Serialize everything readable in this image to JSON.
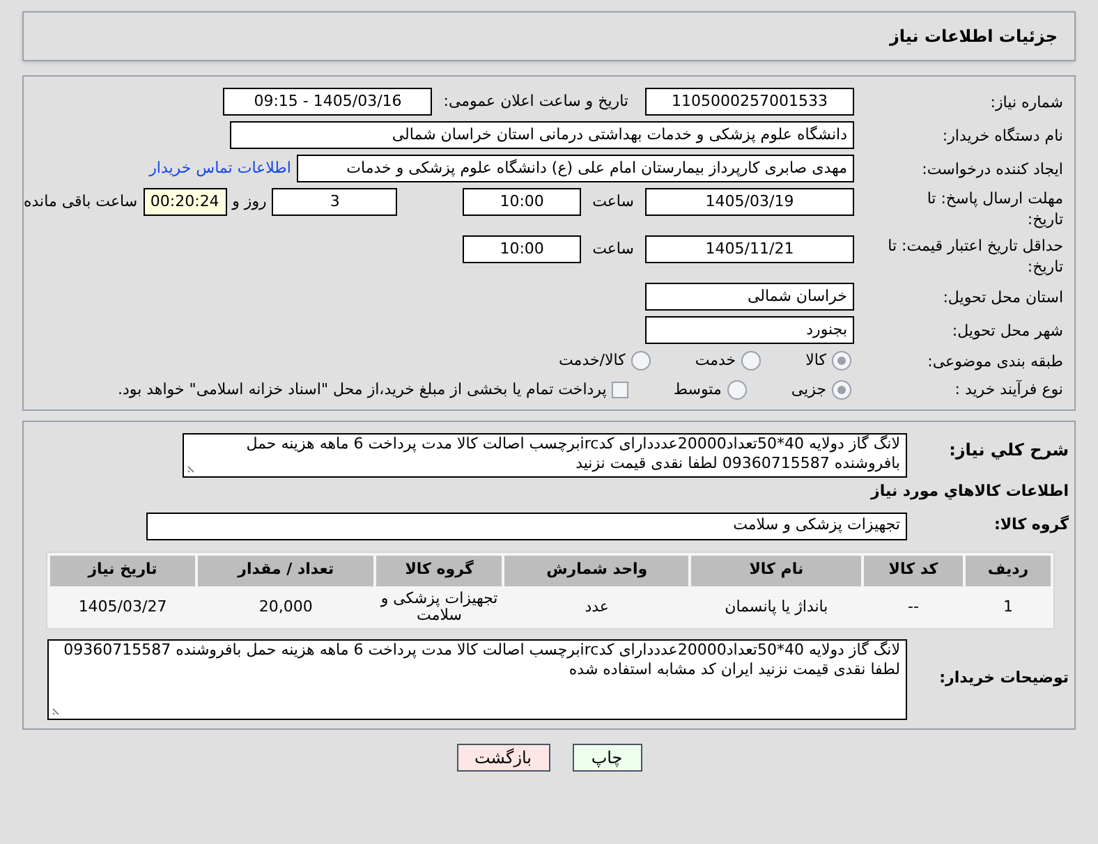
{
  "header": {
    "title": "جزئیات اطلاعات نیاز"
  },
  "need_number": {
    "label": "شماره نیاز:",
    "value": "1105000257001533"
  },
  "announce": {
    "label": "تاریخ و ساعت اعلان عمومی:",
    "value": "1405/03/16 - 09:15"
  },
  "buyer_org": {
    "label": "نام دستگاه خریدار:",
    "value": "دانشگاه علوم پزشکی و خدمات بهداشتی درمانی استان خراسان شمالی"
  },
  "requester": {
    "label": "ایجاد کننده درخواست:",
    "value": "مهدی صابری کارپرداز بیمارستان امام علی (ع) دانشگاه علوم پزشکی و خدمات",
    "link": "اطلاعات تماس خریدار"
  },
  "response_deadline": {
    "label": "مهلت ارسال پاسخ: تا تاریخ:",
    "date": "1405/03/19",
    "time_label": "ساعت",
    "time": "10:00",
    "days": "3",
    "days_label": "روز و",
    "remaining": "00:20:24",
    "remaining_label": "ساعت باقی مانده"
  },
  "price_validity": {
    "label": "حداقل تاریخ اعتبار قیمت: تا تاریخ:",
    "date": "1405/11/21",
    "time_label": "ساعت",
    "time": "10:00"
  },
  "province": {
    "label": "استان محل تحویل:",
    "value": "خراسان شمالی"
  },
  "city": {
    "label": "شهر محل تحویل:",
    "value": "بجنورد"
  },
  "category": {
    "label": "طبقه بندی موضوعی:",
    "options": [
      {
        "label": "کالا",
        "selected": true
      },
      {
        "label": "خدمت",
        "selected": false
      },
      {
        "label": "کالا/خدمت",
        "selected": false
      }
    ]
  },
  "process": {
    "label": "نوع فرآیند خرید :",
    "options": [
      {
        "label": "جزیی",
        "selected": true
      },
      {
        "label": "متوسط",
        "selected": false
      }
    ],
    "payment": {
      "label": "پرداخت تمام یا بخشی از مبلغ خرید،از محل \"اسناد خزانه اسلامی\" خواهد بود.",
      "checked": false
    }
  },
  "description": {
    "label": "شرح کلي نياز:",
    "text": "لانگ گاز دولایه 40*50تعداد20000عدددارای کدircبرچسب اصالت کالا مدت پرداخت 6 ماهه هزینه حمل بافروشنده 09360715587 لطفا نقدی قیمت نزنید"
  },
  "items_heading": "اطلاعات کالاهاي مورد نياز",
  "goods_group": {
    "label": "گروه کالا:",
    "value": "تجهیزات پزشکی و سلامت"
  },
  "table": {
    "columns": [
      "ردیف",
      "کد کالا",
      "نام کالا",
      "واحد شمارش",
      "گروه کالا",
      "تعداد / مقدار",
      "تاریخ نیاز"
    ],
    "rows": [
      {
        "cells": [
          "1",
          "--",
          "بانداژ یا پانسمان",
          "عدد",
          "تجهیزات پزشکی و سلامت",
          "20,000",
          "1405/03/27"
        ]
      }
    ]
  },
  "buyer_notes": {
    "label": "توضیحات خریدار:",
    "text": "لانگ گاز دولایه 40*50تعداد20000عدددارای کدircبرچسب اصالت کالا مدت پرداخت 6 ماهه هزینه حمل بافروشنده 09360715587 لطفا نقدی قیمت نزنید  ایران کد مشابه استفاده شده"
  },
  "buttons": [
    {
      "label": "چاپ",
      "kind": "print"
    },
    {
      "label": "بازگشت",
      "kind": "back"
    }
  ]
}
